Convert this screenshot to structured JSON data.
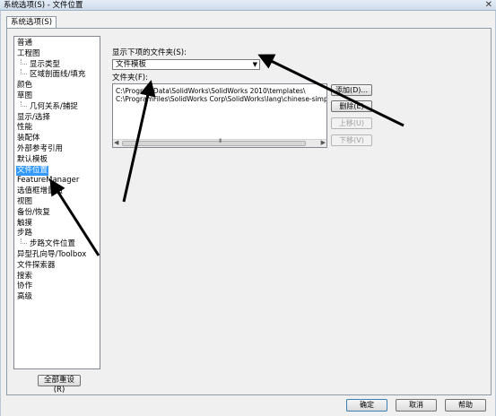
{
  "window": {
    "title": "系统选项(S) - 文件位置",
    "close_glyph": "✕"
  },
  "tab": {
    "label": "系统选项(S)"
  },
  "tree": {
    "items": [
      {
        "label": "普通",
        "level": 0
      },
      {
        "label": "工程图",
        "level": 0
      },
      {
        "label": "显示类型",
        "level": 1
      },
      {
        "label": "区域剖面线/填充",
        "level": 1
      },
      {
        "label": "颜色",
        "level": 0
      },
      {
        "label": "草图",
        "level": 0
      },
      {
        "label": "几何关系/捕捉",
        "level": 1
      },
      {
        "label": "显示/选择",
        "level": 0
      },
      {
        "label": "性能",
        "level": 0
      },
      {
        "label": "装配体",
        "level": 0
      },
      {
        "label": "外部参考引用",
        "level": 0
      },
      {
        "label": "默认模板",
        "level": 0
      },
      {
        "label": "文件位置",
        "level": 0,
        "selected": true
      },
      {
        "label": "FeatureManager",
        "level": 0
      },
      {
        "label": "选值框增量值",
        "level": 0
      },
      {
        "label": "视图",
        "level": 0
      },
      {
        "label": "备份/恢复",
        "level": 0
      },
      {
        "label": "触摸",
        "level": 0
      },
      {
        "label": "步路",
        "level": 0
      },
      {
        "label": "步路文件位置",
        "level": 1
      },
      {
        "label": "异型孔向导/Toolbox",
        "level": 0
      },
      {
        "label": "文件探索器",
        "level": 0
      },
      {
        "label": "搜索",
        "level": 0
      },
      {
        "label": "协作",
        "level": 0
      },
      {
        "label": "高级",
        "level": 0
      }
    ]
  },
  "reset_button": {
    "label": "全部重设(R)"
  },
  "show_folders": {
    "label": "显示下项的文件夹(S):",
    "value": "文件模板",
    "arrow": "▼"
  },
  "folders": {
    "label": "文件夹(F):",
    "paths": [
      "C:\\ProgramData\\SolidWorks\\SolidWorks 2010\\templates\\",
      "C:\\ProgramFiles\\SolidWorks Corp\\SolidWorks\\lang\\chinese-simplified\\Tutorial"
    ],
    "scroll_grip": "III",
    "scroll_left": "◀",
    "scroll_right": "▶"
  },
  "side_buttons": {
    "add": "添加(D)...",
    "delete": "删除(E)",
    "move_up": "上移(U)",
    "move_down": "下移(V)"
  },
  "footer": {
    "ok": "确定",
    "cancel": "取消",
    "help": "帮助"
  }
}
